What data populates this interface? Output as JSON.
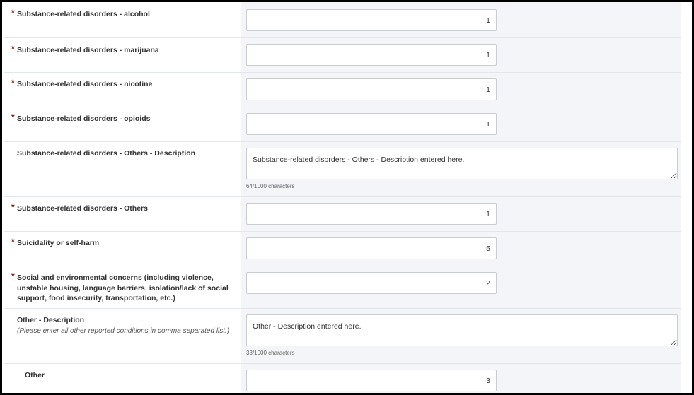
{
  "fields": [
    {
      "label": "Substance-related disorders - alcohol",
      "required": true,
      "value": "1"
    },
    {
      "label": "Substance-related disorders - marijuana",
      "required": true,
      "value": "1"
    },
    {
      "label": "Substance-related disorders - nicotine",
      "required": true,
      "value": "1"
    },
    {
      "label": "Substance-related disorders - opioids",
      "required": true,
      "value": "1"
    },
    {
      "label": "Substance-related disorders - Others - Description",
      "required": false,
      "value": "Substance-related disorders - Others - Description entered here.",
      "counter": "64/1000 characters"
    },
    {
      "label": "Substance-related disorders - Others",
      "required": true,
      "value": "1"
    },
    {
      "label": "Suicidality or self-harm",
      "required": true,
      "value": "5"
    },
    {
      "label": "Social and environmental concerns (including violence, unstable housing, language barriers, isolation/lack of social support, food insecurity, transportation, etc.)",
      "required": true,
      "value": "2"
    },
    {
      "label": "Other - Description",
      "sublabel": "(Please enter all other reported conditions in comma separated list.)",
      "required": false,
      "value": "Other - Description entered here.",
      "counter": "33/1000 characters"
    },
    {
      "label": "Other",
      "required": false,
      "value": "3"
    }
  ],
  "required_marker": "*"
}
